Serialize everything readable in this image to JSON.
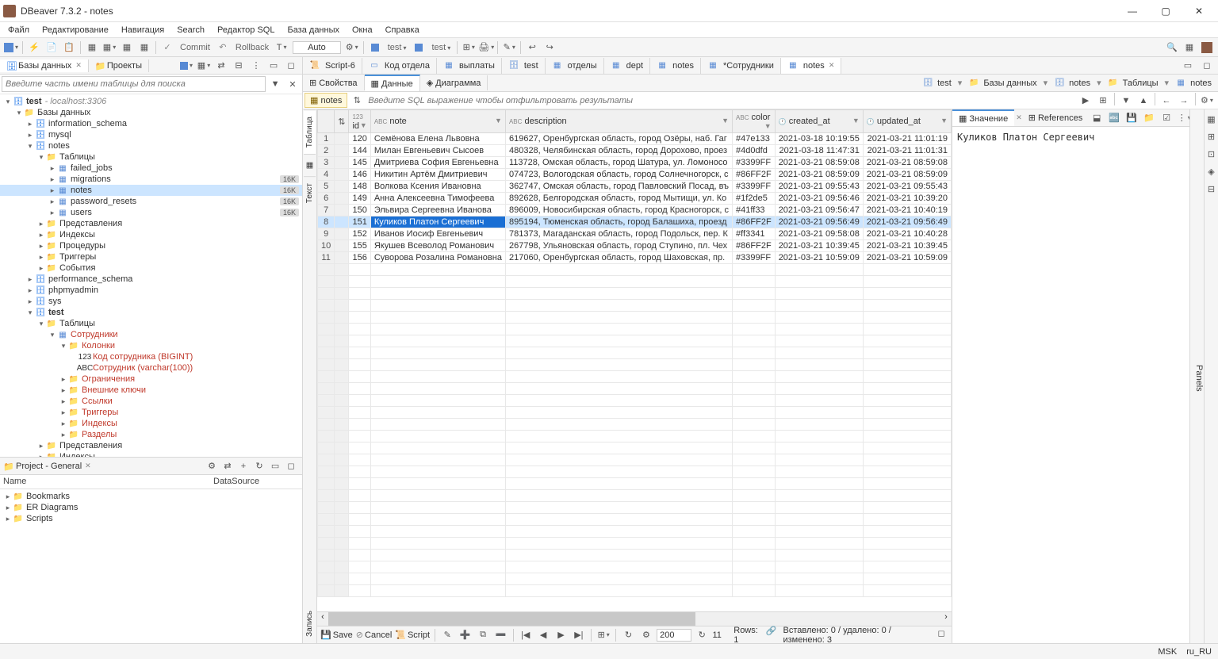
{
  "title": "DBeaver 7.3.2 - notes",
  "menu": [
    "Файл",
    "Редактирование",
    "Навигация",
    "Search",
    "Редактор SQL",
    "База данных",
    "Окна",
    "Справка"
  ],
  "toolbar": {
    "commit": "Commit",
    "rollback": "Rollback",
    "auto": "Auto",
    "conn1": "test",
    "conn2": "test"
  },
  "leftTabs": {
    "databases": "Базы данных",
    "projects": "Проекты"
  },
  "searchPlaceholder": "Введите часть имени таблицы для поиска",
  "tree": {
    "root": "test",
    "rootHost": "- localhost:3306",
    "databases": "Базы данных",
    "schemas": [
      "information_schema",
      "mysql"
    ],
    "notes": "notes",
    "tables": "Таблицы",
    "notesTables": [
      {
        "name": "failed_jobs"
      },
      {
        "name": "migrations",
        "badge": "16K"
      },
      {
        "name": "notes",
        "badge": "16K",
        "selected": true
      },
      {
        "name": "password_resets",
        "badge": "16K"
      },
      {
        "name": "users",
        "badge": "16K"
      }
    ],
    "notesOther": [
      "Представления",
      "Индексы",
      "Процедуры",
      "Триггеры",
      "События"
    ],
    "perfSchema": "performance_schema",
    "phpmyadmin": "phpmyadmin",
    "sys": "sys",
    "test": "test",
    "testTables": "Таблицы",
    "sotr": "Сотрудники",
    "cols": "Колонки",
    "col1": "Код сотрудника (BIGINT)",
    "col2": "Сотрудник (varchar(100))",
    "testSub": [
      "Ограничения",
      "Внешние ключи",
      "Ссылки",
      "Триггеры",
      "Индексы",
      "Разделы"
    ],
    "testOther": [
      "Представления",
      "Индексы",
      "Процедуры"
    ]
  },
  "project": {
    "title": "Project - General",
    "name": "Name",
    "ds": "DataSource",
    "items": [
      "Bookmarks",
      "ER Diagrams",
      "Scripts"
    ]
  },
  "editorTabs": [
    {
      "label": "<test> Script-6",
      "icon": "sql"
    },
    {
      "label": "Код отдела",
      "icon": "col"
    },
    {
      "label": "выплаты",
      "icon": "tbl"
    },
    {
      "label": "test",
      "icon": "db"
    },
    {
      "label": "отделы",
      "icon": "tbl"
    },
    {
      "label": "dept",
      "icon": "tbl"
    },
    {
      "label": "notes",
      "icon": "tbl"
    },
    {
      "label": "*Сотрудники",
      "icon": "tbl"
    },
    {
      "label": "notes",
      "icon": "tbl",
      "active": true,
      "close": true
    }
  ],
  "subTabs": {
    "props": "Свойства",
    "data": "Данные",
    "diag": "Диаграмма"
  },
  "breadcrumb": [
    "test",
    "Базы данных",
    "notes",
    "Таблицы",
    "notes"
  ],
  "filterTable": "notes",
  "filterPlaceholder": "Введите SQL выражение чтобы отфильтровать результаты",
  "vtabs": {
    "table": "Таблица",
    "text": "Текст",
    "record": "Запись"
  },
  "columns": [
    "id",
    "note",
    "description",
    "color",
    "created_at",
    "updated_at"
  ],
  "rows": [
    {
      "n": 1,
      "id": 120,
      "note": "Семёнова Елена Львовна",
      "desc": "619627, Оренбургская область, город Озёры, наб. Гаг",
      "color": "#47e133",
      "c": "2021-03-18 10:19:55",
      "u": "2021-03-21 11:01:19"
    },
    {
      "n": 2,
      "id": 144,
      "note": "Милан Евгеньевич Сысоев",
      "desc": "480328, Челябинская область, город Дорохово, проез",
      "color": "#4d0dfd",
      "c": "2021-03-18 11:47:31",
      "u": "2021-03-21 11:01:31"
    },
    {
      "n": 3,
      "id": 145,
      "note": "Дмитриева София Евгеньевна",
      "desc": "113728, Омская область, город Шатура, ул. Ломоносо",
      "color": "#3399FF",
      "c": "2021-03-21 08:59:08",
      "u": "2021-03-21 08:59:08"
    },
    {
      "n": 4,
      "id": 146,
      "note": "Никитин Артём Дмитриевич",
      "desc": "074723, Вологодская область, город Солнечногорск, с",
      "color": "#86FF2F",
      "c": "2021-03-21 08:59:09",
      "u": "2021-03-21 08:59:09"
    },
    {
      "n": 5,
      "id": 148,
      "note": "Волкова Ксения Ивановна",
      "desc": "362747, Омская область, город Павловский Посад, въ",
      "color": "#3399FF",
      "c": "2021-03-21 09:55:43",
      "u": "2021-03-21 09:55:43"
    },
    {
      "n": 6,
      "id": 149,
      "note": "Анна Алексеевна Тимофеева",
      "desc": "892628, Белгородская область, город Мытищи, ул. Ко",
      "color": "#1f2de5",
      "c": "2021-03-21 09:56:46",
      "u": "2021-03-21 10:39:20"
    },
    {
      "n": 7,
      "id": 150,
      "note": "Эльвира Сергеевна Иванова",
      "desc": "896009, Новосибирская область, город Красногорск, с",
      "color": "#41ff33",
      "c": "2021-03-21 09:56:47",
      "u": "2021-03-21 10:40:19"
    },
    {
      "n": 8,
      "id": 151,
      "note": "Куликов Платон Сергеевич",
      "desc": "895194, Тюменская область, город Балашиха, проезд",
      "color": "#86FF2F",
      "c": "2021-03-21 09:56:49",
      "u": "2021-03-21 09:56:49",
      "sel": true
    },
    {
      "n": 9,
      "id": 152,
      "note": "Иванов Иосиф Евгеньевич",
      "desc": "781373, Магаданская область, город Подольск, пер. К",
      "color": "#ff3341",
      "c": "2021-03-21 09:58:08",
      "u": "2021-03-21 10:40:28"
    },
    {
      "n": 10,
      "id": 155,
      "note": "Якушев Всеволод Романович",
      "desc": "267798, Ульяновская область, город Ступино, пл. Чех",
      "color": "#86FF2F",
      "c": "2021-03-21 10:39:45",
      "u": "2021-03-21 10:39:45"
    },
    {
      "n": 11,
      "id": 156,
      "note": "Суворова Розалина Романовна",
      "desc": "217060, Оренбургская область, город Шаховская, пр.",
      "color": "#3399FF",
      "c": "2021-03-21 10:59:09",
      "u": "2021-03-21 10:59:09"
    }
  ],
  "valuePanel": {
    "value": "Значение",
    "refs": "References",
    "content": "Куликов Платон Сергеевич",
    "panels": "Panels"
  },
  "bottom": {
    "save": "Save",
    "cancel": "Cancel",
    "script": "Script",
    "fetch": "200",
    "total": "11",
    "rows": "Rows: 1",
    "status": "Вставлено: 0 / удалено: 0 / изменено: 3"
  },
  "statusbar": {
    "msk": "MSK",
    "locale": "ru_RU"
  }
}
